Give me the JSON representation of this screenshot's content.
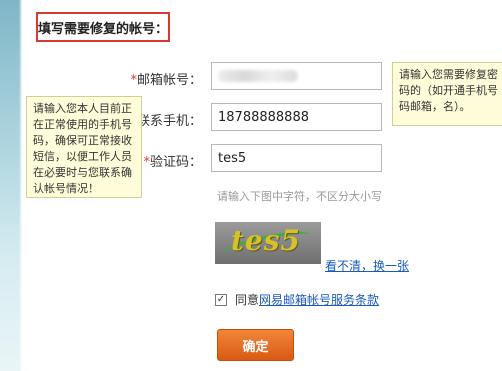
{
  "header": {
    "title": "填写需要修复的帐号："
  },
  "form": {
    "email": {
      "label": "邮箱帐号：",
      "required_mark": "*"
    },
    "phone": {
      "label": "联系手机：",
      "required_mark": "*",
      "value": "18788888888"
    },
    "captcha": {
      "label": "验证码：",
      "required_mark": "*",
      "value": "tes5"
    },
    "captcha_hint": "请输入下图中字符，不区分大小写",
    "captcha_image_text": "tes5",
    "refresh_link": "看不清，换一张",
    "agree": {
      "checked": "✓",
      "prefix": "同意",
      "link_text": "网易邮箱帐号服务条款"
    },
    "confirm_button": "确定"
  },
  "tips": {
    "left": "请输入您本人目前正在正常使用的手机号码，确保可正常接收短信，以便工作人员在必要时与您联系确认帐号情况！",
    "right": "请输入您需要修复密码的（如开通手机号码邮箱，名）。"
  },
  "colors": {
    "accent_red": "#d93a2f",
    "link_blue": "#1a5ab8",
    "button_orange": "#e36a22",
    "tip_bg": "#fffcd9"
  }
}
